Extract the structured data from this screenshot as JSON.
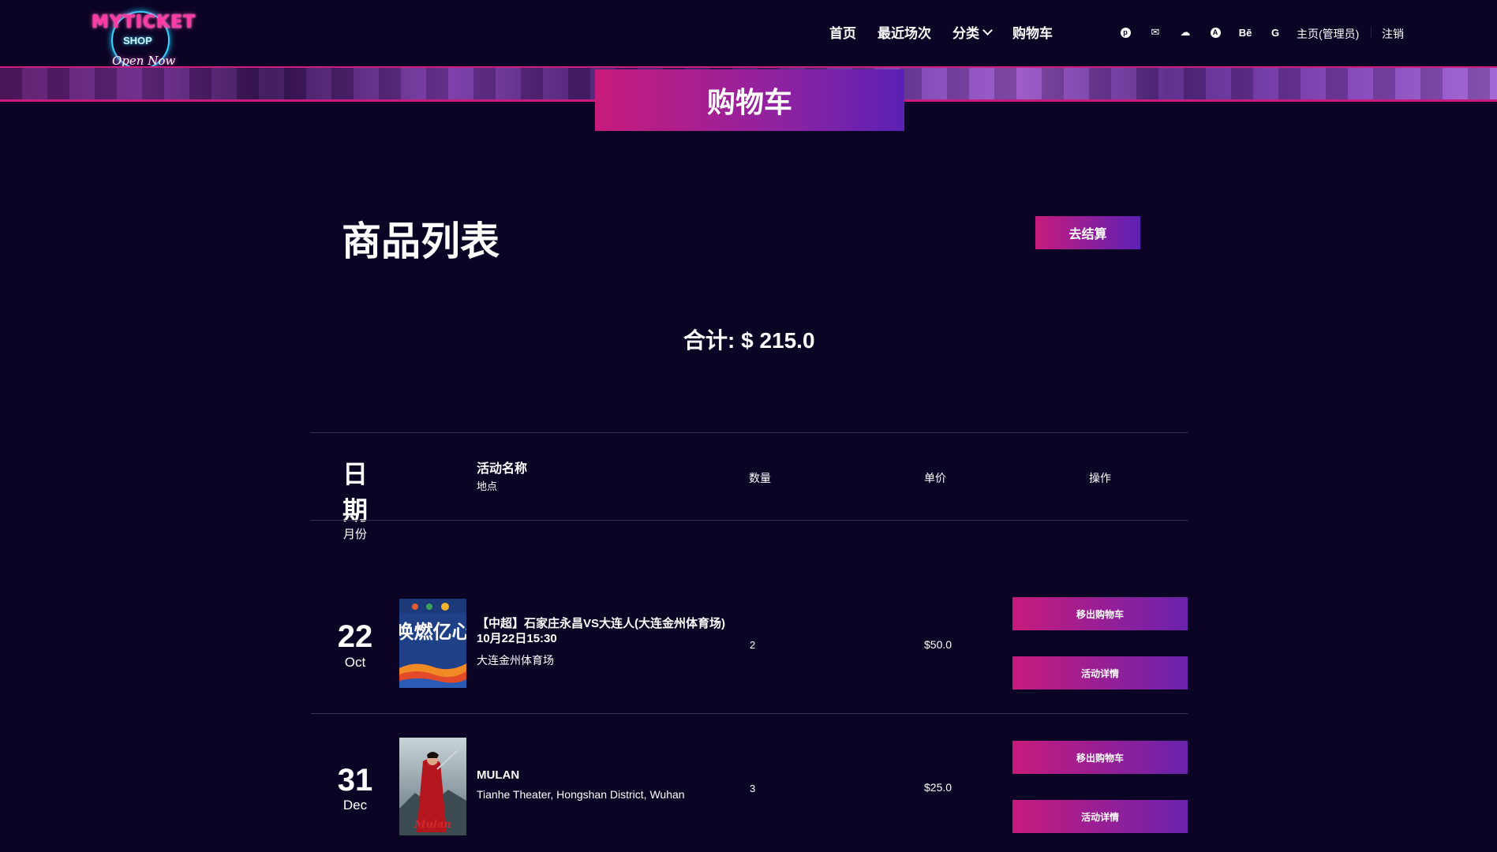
{
  "header": {
    "logo": {
      "top": "MYTICKET",
      "shop": "SHOP",
      "tagline": "Open Now"
    },
    "nav": [
      {
        "label": "首页"
      },
      {
        "label": "最近场次"
      },
      {
        "label": "分类"
      },
      {
        "label": "购物车"
      }
    ],
    "socials": [
      "pinterest-icon",
      "wechat-icon",
      "weibo-icon",
      "circle-a-icon",
      "behance-icon",
      "google-icon"
    ],
    "social_glyphs": {
      "pinterest": "p",
      "wechat": "✉",
      "weibo": "☁",
      "circle": "A",
      "behance": "Bē",
      "google": "G"
    },
    "account": "主页(管理员)",
    "logout": "注销"
  },
  "page_title": "购物车",
  "list_heading": "商品列表",
  "checkout_button": "去结算",
  "total_label": "合计: $ 215.0",
  "table_header": {
    "date_big": "日期",
    "date_small": "月份",
    "event_name": "活动名称",
    "venue": "地点",
    "quantity": "数量",
    "unit_price": "单价",
    "operations": "操作"
  },
  "rows": [
    {
      "day": "22",
      "month": "Oct",
      "poster_text": "唤燃亿心",
      "title_line1": "【中超】石家庄永昌VS大连人(大连金州体育场)",
      "title_line2": "10月22日15:30",
      "venue": "大连金州体育场",
      "quantity": "2",
      "price": "$50.0",
      "remove_label": "移出购物车",
      "detail_label": "活动详情"
    },
    {
      "day": "31",
      "month": "Dec",
      "poster_text": "Mulan",
      "title_line1": "MULAN",
      "title_line2": "",
      "venue": "Tianhe Theater, Hongshan District, Wuhan",
      "quantity": "3",
      "price": "$25.0",
      "remove_label": "移出购物车",
      "detail_label": "活动详情"
    }
  ],
  "colors": {
    "background": "#0b0425",
    "accent_pink": "#c71b7c",
    "accent_purple": "#5b21b5"
  }
}
